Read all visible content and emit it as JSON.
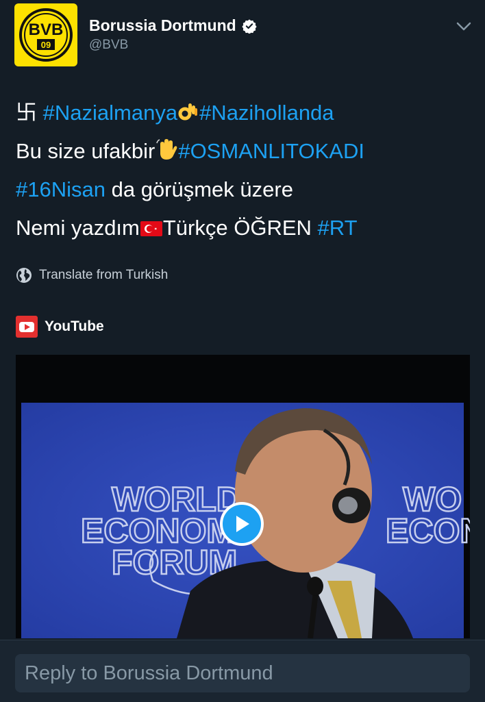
{
  "header": {
    "avatar_text": "BVB 09",
    "display_name": "Borussia Dortmund",
    "handle": "@BVB"
  },
  "tweet": {
    "line1": {
      "symbol": "卐",
      "tag1": "#Nazialmanya",
      "emoji1": "ok-hand",
      "tag2": "#Nazihollanda"
    },
    "line2": {
      "text": "Bu size ufakbir",
      "emoji": "waving-hand",
      "tag": "#OSMANLITOKADI"
    },
    "line3": {
      "tag": "#16Nisan",
      "text": " da görüşmek üzere"
    },
    "line4": {
      "text1": "Nemi yazdım",
      "emoji": "turkey-flag",
      "text2": "Türkçe ÖĞREN ",
      "tag": "#RT"
    }
  },
  "translate_label": "Translate from Turkish",
  "card": {
    "source_name": "YouTube",
    "video_sign_left": [
      "WORLD",
      "ECONOMIC",
      "FORUM"
    ],
    "video_sign_right": [
      "WO",
      "ECON"
    ]
  },
  "reply": {
    "placeholder": "Reply to Borussia Dortmund"
  },
  "colors": {
    "background": "#141d26",
    "link": "#1da1f2",
    "muted": "#8899a6",
    "bvb_yellow": "#fde100"
  }
}
